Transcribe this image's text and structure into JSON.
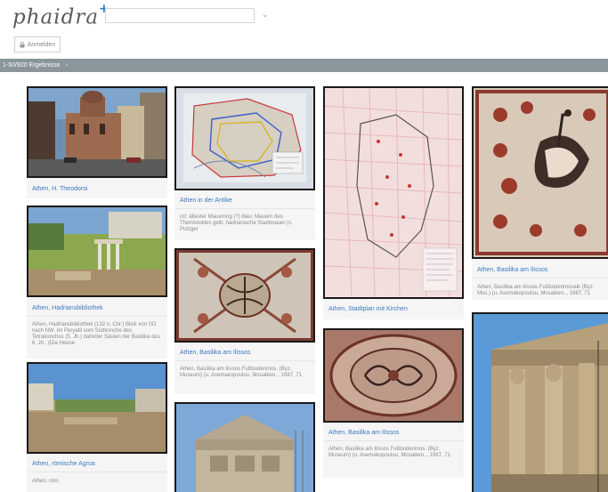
{
  "header": {
    "logo_text": "phaidra",
    "logo_plus": "+",
    "search_value": "",
    "login_label": "Anmelden"
  },
  "results": {
    "label": "1-50/920 Ergebnisse",
    "arrow": "›"
  },
  "cards": [
    {
      "title": "Athen, H. Theodoroi",
      "description": ""
    },
    {
      "title": "Athen, Hadriansbibliothek",
      "description": "Athen, Hadriansbibliothek (132 n. Chr.) Blick von SO nach NW. Im Peryatil vom Südkonche des Tetrakonchos (5. Jh.) dahinter Säulen der Basilika des 6. Jh.. (Dia Heese"
    },
    {
      "title": "Athen, römische Agroa",
      "description": "Athen, röm."
    },
    {
      "title": "Athen in der Antike",
      "description": "rot: ältester Mauerring (?) blau: Mauern des Themistokles gelb: hadrianische Stadtmauer (n. Putzger"
    },
    {
      "title": "Athen, Basilika am Ilissos",
      "description": "Athen, Basilika am Ilissos Fußbodenmos. (Byz. Museum) (u. Asemakopoulou, Mosaiken.., 1987, 71"
    },
    {
      "title": "Athen, Stadtplan mit Kirchen",
      "description": ""
    },
    {
      "title": "Athen, Basilika am Ilissos",
      "description": "Athen, Basilika am Ilissos Fußbodenmos. (Byz. Museum) (u. Asemakopoulou, Mosaiken.., 1987, 71"
    },
    {
      "title": "Athen, Basilika am Ilissos",
      "description": "Athen, Basilika am Ilissos Fußbodenmosaik (Byz. Mus.) (u. Asemakopoulou, Mosaiken.., 1987, 71"
    }
  ],
  "colors": {
    "accent": "#3a78c0",
    "bar": "#8a959c",
    "logo_plus": "#2a78c8"
  }
}
